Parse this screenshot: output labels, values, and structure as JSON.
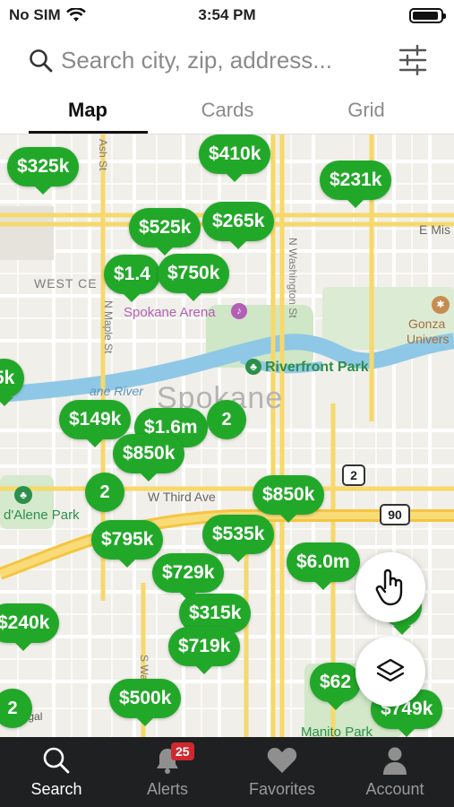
{
  "status_bar": {
    "carrier": "No SIM",
    "time": "3:54 PM"
  },
  "search": {
    "placeholder": "Search city, zip, address..."
  },
  "tabs": [
    {
      "label": "Map",
      "active": true
    },
    {
      "label": "Cards",
      "active": false
    },
    {
      "label": "Grid",
      "active": false
    }
  ],
  "map": {
    "labels": {
      "west_central": "WEST CE",
      "spokane_arena": "Spokane Arena",
      "riverfront_park": "Riverfront Park",
      "spokane": "Spokane",
      "spokane_river": "ane River",
      "gonzaga": "Gonza",
      "gonzaga_2": "Univers",
      "coeur_dalene_park": "d'Alene Park",
      "manito_park": "Manito Park",
      "w_third_ave": "W Third Ave",
      "e_mission": "E Mis",
      "n_maple_st": "N Maple St",
      "n_washington_st": "N Washington St",
      "ash_st": "Ash St",
      "s_washington": "S Wa",
      "route_2": "2",
      "route_90": "90",
      "legal": "Legal"
    },
    "pins": [
      {
        "label": "$325k"
      },
      {
        "label": "$410k"
      },
      {
        "label": "$231k"
      },
      {
        "label": "$525k"
      },
      {
        "label": "$265k"
      },
      {
        "label": "$1.4"
      },
      {
        "label": "$750k"
      },
      {
        "label": "5k"
      },
      {
        "label": "$149k"
      },
      {
        "label": "$1.6m"
      },
      {
        "label": "$850k"
      },
      {
        "label": "$850k"
      },
      {
        "label": "$795k"
      },
      {
        "label": "$535k"
      },
      {
        "label": "$729k"
      },
      {
        "label": "$6.0m"
      },
      {
        "label": "9k"
      },
      {
        "label": "$240k"
      },
      {
        "label": "$315k"
      },
      {
        "label": "$719k"
      },
      {
        "label": "$500k"
      },
      {
        "label": "$62"
      },
      {
        "label": "$749k"
      }
    ],
    "clusters": [
      {
        "label": "2"
      },
      {
        "label": "2"
      },
      {
        "label": "2"
      }
    ]
  },
  "bottom_nav": [
    {
      "label": "Search",
      "active": true,
      "icon": "search-icon"
    },
    {
      "label": "Alerts",
      "active": false,
      "icon": "bell-icon",
      "badge": "25"
    },
    {
      "label": "Favorites",
      "active": false,
      "icon": "heart-icon"
    },
    {
      "label": "Account",
      "active": false,
      "icon": "person-icon"
    }
  ],
  "colors": {
    "pin_green": "#22a829",
    "nav_bg": "#1f2022",
    "badge_red": "#d0282e"
  }
}
